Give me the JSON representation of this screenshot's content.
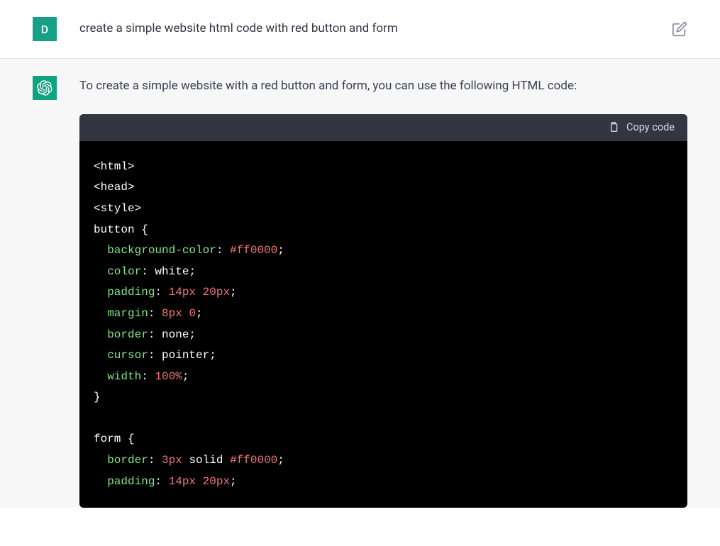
{
  "user": {
    "avatar_letter": "D",
    "message": "create a simple website html code with red button and form"
  },
  "assistant": {
    "intro": "To create a simple website with a red button and form, you can use the following HTML code:"
  },
  "code": {
    "copy_label": "Copy code",
    "lines": {
      "l1": "<html>",
      "l2": "<head>",
      "l3": "<style>",
      "l4_a": "button",
      "l4_b": " {",
      "l5_prop": "background-color",
      "l5_val": "#ff0000",
      "l6_prop": "color",
      "l6_val": "white",
      "l7_prop": "padding",
      "l7_val_a": "14px",
      "l7_val_b": "20px",
      "l8_prop": "margin",
      "l8_val_a": "8px",
      "l8_val_b": "0",
      "l9_prop": "border",
      "l9_val": "none",
      "l10_prop": "cursor",
      "l10_val": "pointer",
      "l11_prop": "width",
      "l11_val": "100%",
      "l12": "}",
      "l14_a": "form",
      "l14_b": " {",
      "l15_prop": "border",
      "l15_val_a": "3px",
      "l15_val_b": "solid",
      "l15_val_c": "#ff0000",
      "l16_prop": "padding",
      "l16_val_a": "14px",
      "l16_val_b": "20px"
    }
  }
}
